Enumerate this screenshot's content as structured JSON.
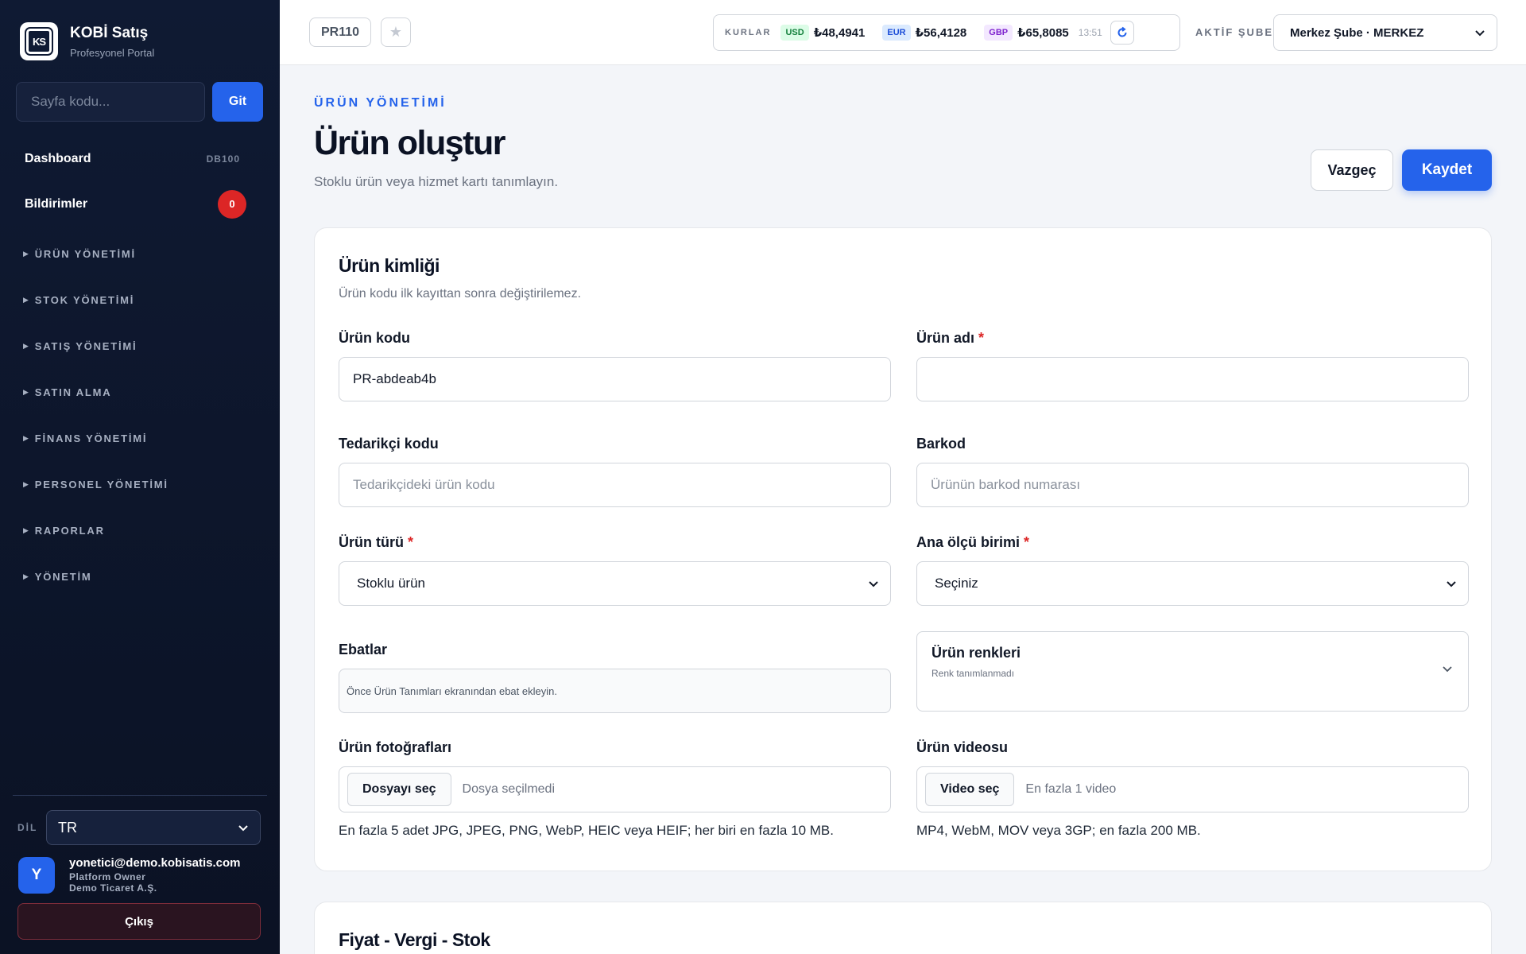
{
  "brand": {
    "title": "KOBİ Satış",
    "subtitle": "Profesyonel Portal",
    "logo_text": "KS"
  },
  "sidebar": {
    "search_placeholder": "Sayfa kodu...",
    "go_label": "Git",
    "dashboard": {
      "label": "Dashboard",
      "code": "DB100"
    },
    "notifications": {
      "label": "Bildirimler",
      "count": "0"
    },
    "groups": [
      {
        "label": "ÜRÜN YÖNETİMİ"
      },
      {
        "label": "STOK YÖNETİMİ"
      },
      {
        "label": "SATIŞ YÖNETİMİ"
      },
      {
        "label": "SATIN ALMA"
      },
      {
        "label": "FİNANS YÖNETİMİ"
      },
      {
        "label": "PERSONEL YÖNETİMİ"
      },
      {
        "label": "RAPORLAR"
      },
      {
        "label": "YÖNETİM"
      }
    ],
    "language_label": "DİL",
    "language_value": "TR",
    "user": {
      "initial": "Y",
      "email": "yonetici@demo.kobisatis.com",
      "role": "Platform Owner",
      "company": "Demo Ticaret A.Ş."
    },
    "logout_label": "Çıkış"
  },
  "topbar": {
    "page_code": "PR110",
    "rates_label": "KURLAR",
    "rates": [
      {
        "code": "USD",
        "value": "₺48,4941",
        "bg": "#dcfce7",
        "fg": "#15803d"
      },
      {
        "code": "EUR",
        "value": "₺56,4128",
        "bg": "#dbeafe",
        "fg": "#1d4ed8"
      },
      {
        "code": "GBP",
        "value": "₺65,8085",
        "bg": "#f3e8ff",
        "fg": "#7e22ce"
      }
    ],
    "rates_time": "13:51",
    "branch_label": "AKTİF ŞUBE",
    "branch_value": "Merkez Şube · MERKEZ"
  },
  "page": {
    "eyebrow": "ÜRÜN YÖNETİMİ",
    "title": "Ürün oluştur",
    "subtitle": "Stoklu ürün veya hizmet kartı tanımlayın.",
    "cancel_label": "Vazgeç",
    "save_label": "Kaydet"
  },
  "identity_card": {
    "title": "Ürün kimliği",
    "subtitle": "Ürün kodu ilk kayıttan sonra değiştirilemez.",
    "product_code": {
      "label": "Ürün kodu",
      "value": "PR-abdeab4b"
    },
    "product_name": {
      "label": "Ürün adı",
      "required": "*",
      "value": ""
    },
    "supplier_code": {
      "label": "Tedarikçi kodu",
      "placeholder": "Tedarikçideki ürün kodu"
    },
    "barcode": {
      "label": "Barkod",
      "placeholder": "Ürünün barkod numarası"
    },
    "product_type": {
      "label": "Ürün türü",
      "required": "*",
      "value": "Stoklu ürün"
    },
    "unit": {
      "label": "Ana ölçü birimi",
      "required": "*",
      "value": "Seçiniz"
    },
    "sizes": {
      "label": "Ebatlar",
      "note": "Önce Ürün Tanımları ekranından ebat ekleyin."
    },
    "colors": {
      "title": "Ürün renkleri",
      "subtitle": "Renk tanımlanmadı"
    },
    "photos": {
      "label": "Ürün fotoğrafları",
      "button": "Dosyayı seç",
      "state": "Dosya seçilmedi",
      "help": "En fazla 5 adet JPG, JPEG, PNG, WebP, HEIC veya HEIF; her biri en fazla 10 MB."
    },
    "video": {
      "label": "Ürün videosu",
      "button": "Video seç",
      "state": "En fazla 1 video",
      "help": "MP4, WebM, MOV veya 3GP; en fazla 200 MB."
    }
  },
  "price_card": {
    "title": "Fiyat - Vergi - Stok"
  }
}
